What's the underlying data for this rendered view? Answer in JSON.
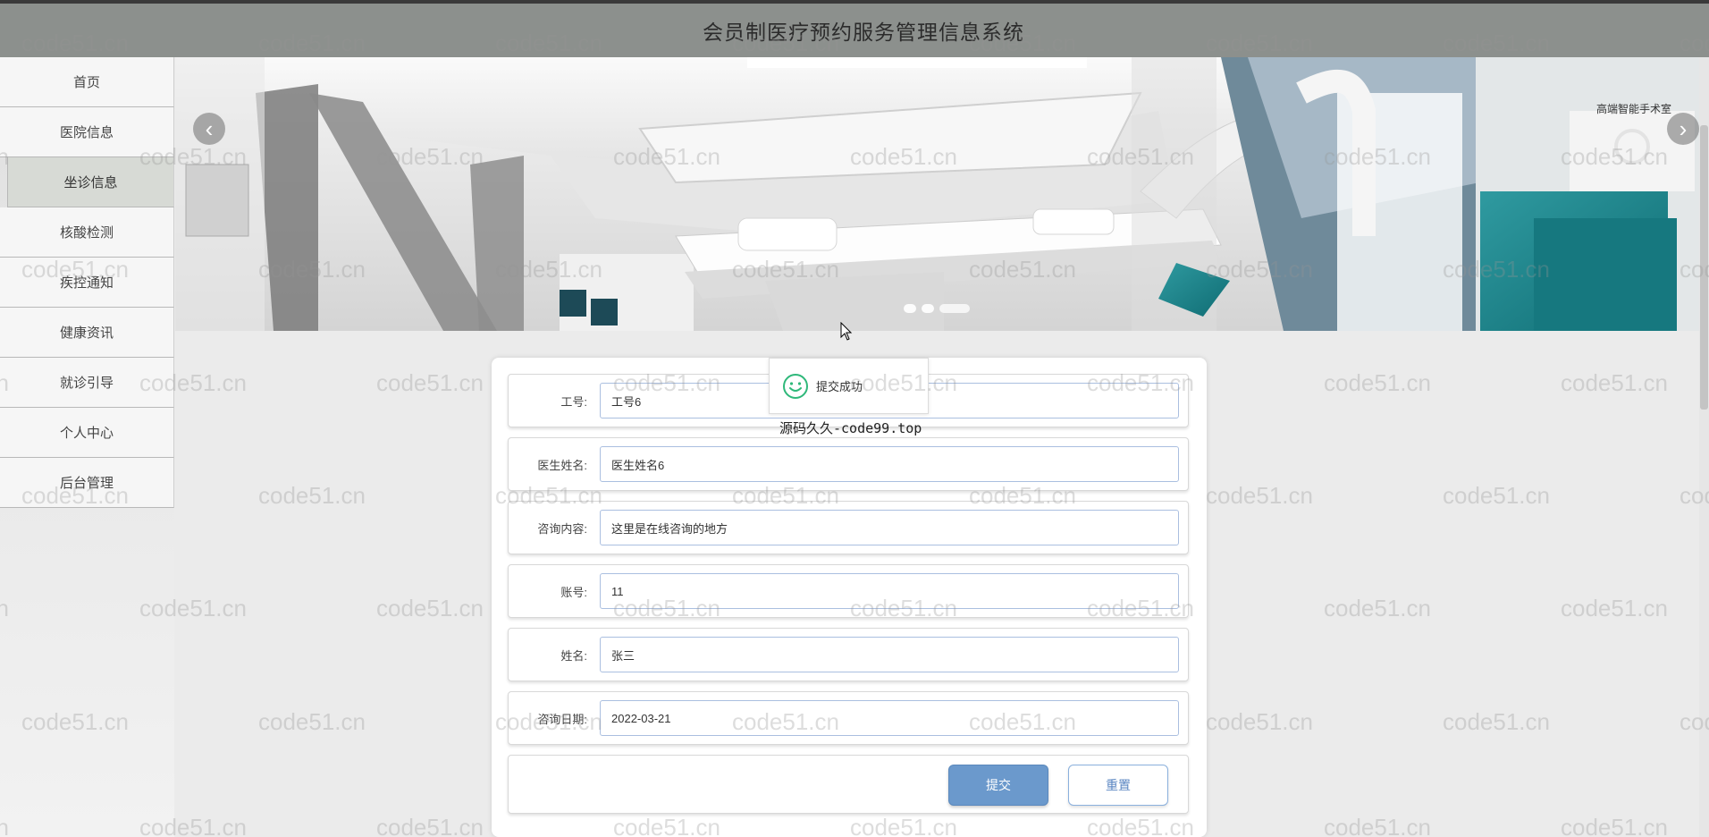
{
  "header": {
    "title": "会员制医疗预约服务管理信息系统"
  },
  "sidebar": {
    "items": [
      {
        "label": "首页"
      },
      {
        "label": "医院信息"
      },
      {
        "label": "坐诊信息"
      },
      {
        "label": "核酸检测"
      },
      {
        "label": "疾控通知"
      },
      {
        "label": "健康资讯"
      },
      {
        "label": "就诊引导"
      },
      {
        "label": "个人中心"
      },
      {
        "label": "后台管理"
      }
    ],
    "active_index": 2
  },
  "banner": {
    "arrow_prev": "‹",
    "arrow_next": "›",
    "slide_count": 3,
    "active_slide": 2,
    "sign_text": "高端智能手术室"
  },
  "toast": {
    "text": "提交成功",
    "icon": "smile-icon"
  },
  "site_mark": "源码久久-code99.top",
  "watermark": "code51.cn",
  "form": {
    "fields": [
      {
        "label": "工号:",
        "value": "工号6"
      },
      {
        "label": "医生姓名:",
        "value": "医生姓名6"
      },
      {
        "label": "咨询内容:",
        "value": "这里是在线咨询的地方"
      },
      {
        "label": "账号:",
        "value": "11"
      },
      {
        "label": "姓名:",
        "value": "张三"
      },
      {
        "label": "咨询日期:",
        "value": "2022-03-21"
      }
    ],
    "submit_label": "提交",
    "reset_label": "重置"
  },
  "colors": {
    "header_bg": "#8c908d",
    "submit_bg": "#6b99cc",
    "reset_text": "#5a86c2",
    "toast_icon": "#2fb87a"
  }
}
